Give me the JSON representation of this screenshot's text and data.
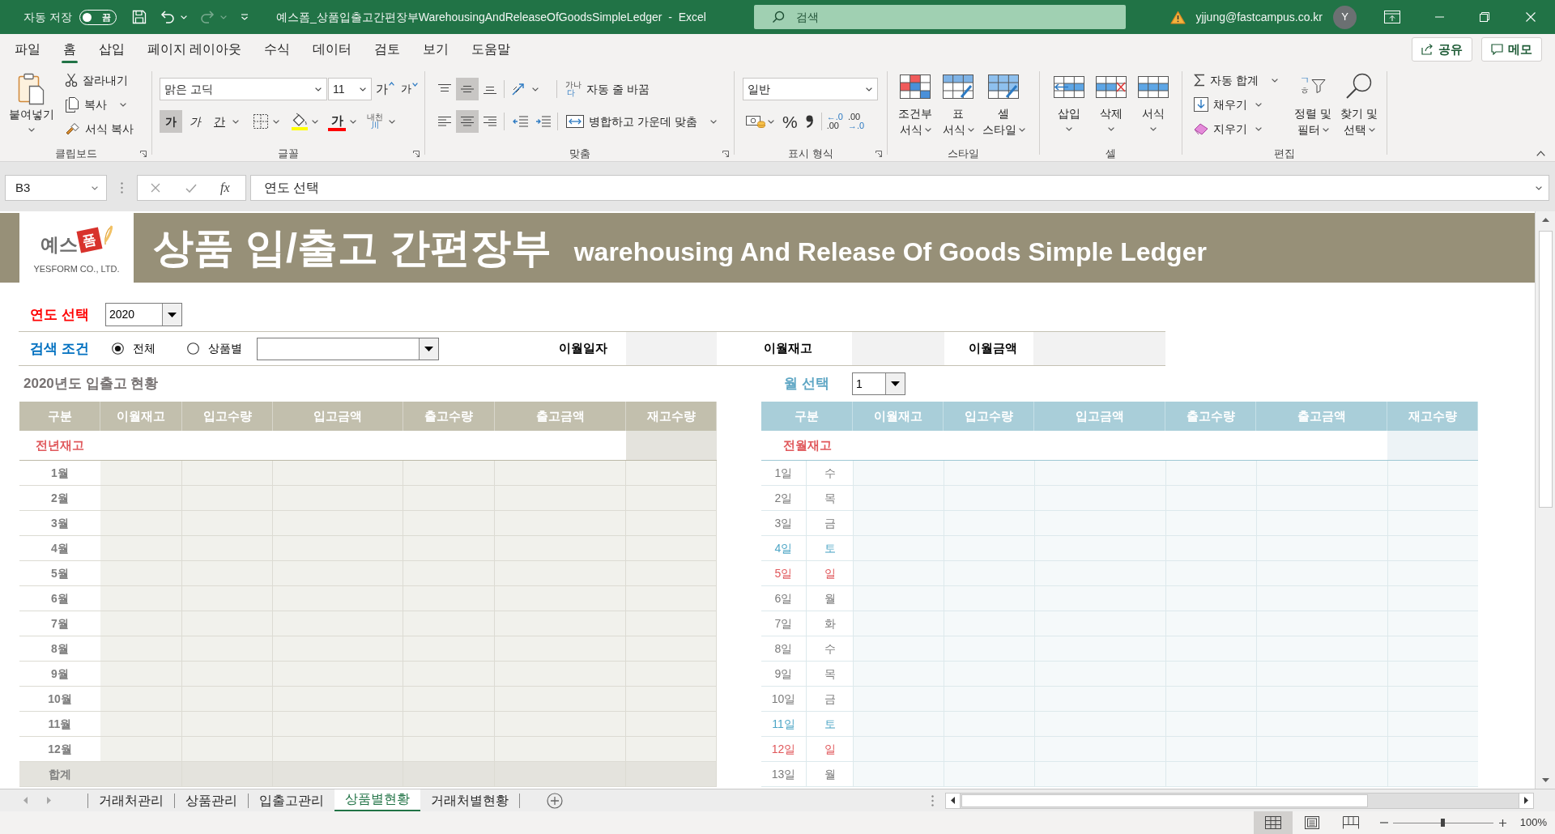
{
  "title_bar": {
    "autosave": {
      "label": "자동 저장",
      "on": false,
      "text": "끔"
    },
    "quick_access": [
      {
        "kind": "save",
        "disabled": false
      },
      {
        "kind": "undo",
        "disabled": false
      },
      {
        "kind": "redo",
        "disabled": true
      }
    ],
    "title": "예스폼_상품입출고간편장부WarehousingAndReleaseOfGoodsSimpleLedger  -  Excel",
    "search": {
      "placeholder": "검색"
    },
    "account": "yjjung@fastcampus.co.kr",
    "avatar": "Y"
  },
  "ribbon_tabs": [
    {
      "label": "파일",
      "selected": false
    },
    {
      "label": "홈",
      "selected": true
    },
    {
      "label": "삽입",
      "selected": false
    },
    {
      "label": "페이지 레이아웃",
      "selected": false
    },
    {
      "label": "수식",
      "selected": false
    },
    {
      "label": "데이터",
      "selected": false
    },
    {
      "label": "검토",
      "selected": false
    },
    {
      "label": "보기",
      "selected": false
    },
    {
      "label": "도움말",
      "selected": false
    }
  ],
  "share_button": "공유",
  "comments_button": "메모",
  "ribbon": {
    "clipboard": {
      "label": "클립보드",
      "paste": "붙여넣기",
      "cut": "잘라내기",
      "copy": "복사",
      "format_painter": "서식 복사"
    },
    "font": {
      "label": "글꼴",
      "font_name": "맑은 고딕",
      "font_size": "11",
      "grow": "가",
      "shrink": "가",
      "styles": [
        {
          "kind": "bold",
          "text": "가",
          "selected": true
        },
        {
          "kind": "italic",
          "text": "가",
          "selected": false
        },
        {
          "kind": "underline",
          "text": "간",
          "selected": false
        }
      ],
      "font_color": "가",
      "phonetic": [
        "내천",
        "川"
      ]
    },
    "alignment": {
      "label": "맞춤",
      "vertical": [
        {
          "kind": "top",
          "selected": false
        },
        {
          "kind": "middle",
          "selected": true
        },
        {
          "kind": "bottom",
          "selected": false
        }
      ],
      "horizontal": [
        {
          "kind": "left",
          "selected": false
        },
        {
          "kind": "center",
          "selected": true
        },
        {
          "kind": "right",
          "selected": false
        }
      ],
      "wrap_text": {
        "icon_text": [
          "가나",
          "다"
        ],
        "label": "자동 줄 바꿈"
      },
      "merge": "병합하고 가운데 맞춤"
    },
    "number": {
      "label": "표시 형식",
      "format": "일반",
      "percent": "%",
      "decimals": [
        {
          "kind": "increase",
          "lines": [
            "←.0",
            ".00"
          ]
        },
        {
          "kind": "decrease",
          "lines": [
            ".00",
            "→.0"
          ]
        }
      ]
    },
    "styles": {
      "label": "스타일",
      "buttons": [
        {
          "kind": "conditional",
          "lines": [
            "조건부",
            "서식"
          ]
        },
        {
          "kind": "table",
          "lines": [
            "표",
            "서식"
          ]
        },
        {
          "kind": "cell",
          "lines": [
            "셀",
            "스타일"
          ]
        }
      ]
    },
    "cells": {
      "label": "셀",
      "buttons": [
        {
          "kind": "insert",
          "text": "삽입"
        },
        {
          "kind": "delete",
          "text": "삭제"
        },
        {
          "kind": "format",
          "text": "서식"
        }
      ]
    },
    "editing": {
      "label": "편집",
      "small": [
        {
          "kind": "sum",
          "text": "자동 합계"
        },
        {
          "kind": "fill",
          "text": "채우기"
        },
        {
          "kind": "clear",
          "text": "지우기"
        }
      ],
      "large": [
        {
          "kind": "sort",
          "icon_text": [
            "ㄱ",
            "ㅎ"
          ],
          "lines": [
            "정렬 및",
            "필터"
          ]
        },
        {
          "kind": "find",
          "lines": [
            "찾기 및",
            "선택"
          ]
        }
      ]
    }
  },
  "formula_bar": {
    "name_box": "B3",
    "function_button": "fx",
    "formula": "연도 선택"
  },
  "sheet": {
    "banner": {
      "logo": {
        "mark": "예스",
        "badge": "폼",
        "company": "YESFORM CO., LTD."
      },
      "title": "상품 입/출고 간편장부",
      "subtitle": "warehousing And Release Of Goods Simple Ledger"
    },
    "year_select": {
      "label": "연도 선택",
      "value": "2020"
    },
    "search_condition": {
      "label": "검색 조건",
      "options": [
        {
          "label": "전체",
          "selected": true
        },
        {
          "label": "상품별",
          "selected": false
        }
      ]
    },
    "carry_over": [
      "이월일자",
      "이월재고",
      "이월금액"
    ],
    "yearly_table": {
      "title": "2020년도 입출고 현황",
      "columns": [
        "구분",
        "이월재고",
        "입고수량",
        "입고금액",
        "출고수량",
        "출고금액",
        "재고수량"
      ],
      "opening_row": "전년재고",
      "rows": [
        "1월",
        "2월",
        "3월",
        "4월",
        "5월",
        "6월",
        "7월",
        "8월",
        "9월",
        "10월",
        "11월",
        "12월"
      ],
      "total_row": "합계"
    },
    "month_select": {
      "label": "월 선택",
      "value": "1"
    },
    "daily_table": {
      "columns": [
        "구분",
        "이월재고",
        "입고수량",
        "입고금액",
        "출고수량",
        "출고금액",
        "재고수량"
      ],
      "opening_row": "전월재고",
      "rows": [
        {
          "day": "1일",
          "weekday": "수",
          "color": "#7a7a7a"
        },
        {
          "day": "2일",
          "weekday": "목",
          "color": "#7a7a7a"
        },
        {
          "day": "3일",
          "weekday": "금",
          "color": "#7a7a7a"
        },
        {
          "day": "4일",
          "weekday": "토",
          "color": "#4ea6c6"
        },
        {
          "day": "5일",
          "weekday": "일",
          "color": "#e0575a"
        },
        {
          "day": "6일",
          "weekday": "월",
          "color": "#7a7a7a"
        },
        {
          "day": "7일",
          "weekday": "화",
          "color": "#7a7a7a"
        },
        {
          "day": "8일",
          "weekday": "수",
          "color": "#7a7a7a"
        },
        {
          "day": "9일",
          "weekday": "목",
          "color": "#7a7a7a"
        },
        {
          "day": "10일",
          "weekday": "금",
          "color": "#7a7a7a"
        },
        {
          "day": "11일",
          "weekday": "토",
          "color": "#4ea6c6"
        },
        {
          "day": "12일",
          "weekday": "일",
          "color": "#e0575a"
        },
        {
          "day": "13일",
          "weekday": "월",
          "color": "#7a7a7a"
        }
      ]
    }
  },
  "sheet_tabs": [
    {
      "label": "거래처관리",
      "selected": false
    },
    {
      "label": "상품관리",
      "selected": false
    },
    {
      "label": "입출고관리",
      "selected": false
    },
    {
      "label": "상품별현황",
      "selected": true
    },
    {
      "label": "거래처별현황",
      "selected": false
    }
  ],
  "status_bar": {
    "views": [
      {
        "kind": "normal",
        "selected": true
      },
      {
        "kind": "page_layout",
        "selected": false
      },
      {
        "kind": "page_break",
        "selected": false
      }
    ],
    "zoom": {
      "level": 0.5,
      "text": "100%"
    }
  }
}
